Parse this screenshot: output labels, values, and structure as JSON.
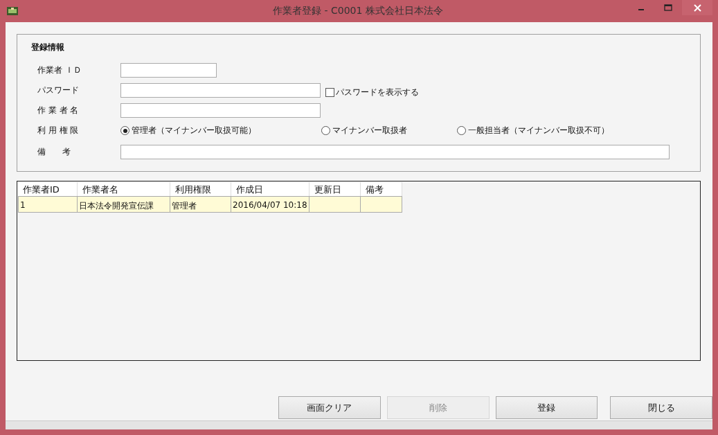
{
  "window": {
    "title": "作業者登録 - C0001 株式会社日本法令"
  },
  "form": {
    "title": "登録情報",
    "worker_id": {
      "label": "作業者 ＩＤ"
    },
    "password": {
      "label": "パスワード",
      "show_password": {
        "label": "パスワードを表示する",
        "checked": false
      }
    },
    "worker_name": {
      "label": "作 業 者 名"
    },
    "permission": {
      "label": "利 用 権 限",
      "options": [
        {
          "label": "管理者（マイナンバー取扱可能）",
          "selected": true
        },
        {
          "label": "マイナンバー取扱者",
          "selected": false
        },
        {
          "label": "一般担当者（マイナンバー取扱不可）",
          "selected": false
        }
      ]
    },
    "remarks": {
      "label": "備　　考"
    }
  },
  "table": {
    "columns": [
      "作業者ID",
      "作業者名",
      "利用権限",
      "作成日",
      "更新日",
      "備考"
    ],
    "rows": [
      [
        "1",
        "日本法令開発宣伝課",
        "管理者",
        "2016/04/07 10:18",
        null,
        null
      ]
    ]
  },
  "buttons": [
    {
      "label": "画面クリア",
      "disabled": false
    },
    {
      "label": "削除",
      "disabled": true
    },
    {
      "label": "登録",
      "disabled": false
    },
    {
      "label": "閉じる",
      "disabled": false
    }
  ]
}
